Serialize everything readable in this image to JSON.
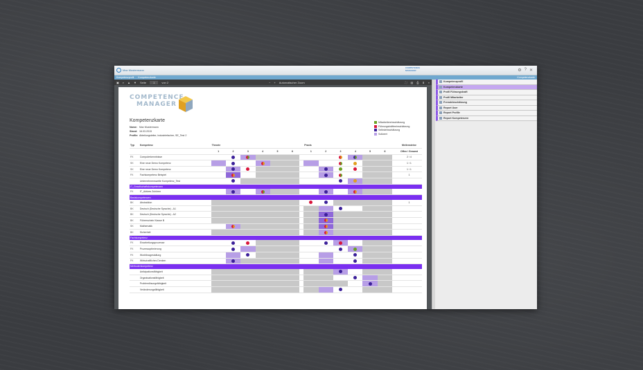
{
  "app": {
    "title": "Max Mustermann",
    "tabs": [
      "Kompetenzprofil",
      "Kompetenzkarte"
    ],
    "header_right_link": "Kompetenzkarte"
  },
  "pdf_toolbar": {
    "page_label": "Seite",
    "page_value": "1",
    "page_total": "von 2",
    "zoom": "Automatischer Zoom"
  },
  "doc": {
    "logo_line1": "COMPETENCE",
    "logo_line2": "MANAGER",
    "title": "Kompetenzkarte",
    "meta": [
      {
        "label": "Name:",
        "value": "Max Mustermann"
      },
      {
        "label": "Stand:",
        "value": "16.03.2015"
      },
      {
        "label": "Profile:",
        "value": "Abteilungsleiter, Industriefacher, SE_Test 2"
      }
    ],
    "legend": [
      {
        "label": "Mitarbeitereinschätzung",
        "color": "#6aa022"
      },
      {
        "label": "Führungskräfteeinschätzung",
        "color": "#d8143a"
      },
      {
        "label": "Selbsteinschätzung",
        "color": "#3b1f99"
      },
      {
        "label": "Sollwert",
        "color": "#b79ee6"
      }
    ],
    "head": {
      "typ": "Typ",
      "komp": "Kompetenz",
      "theorie": "Theorie",
      "praxis": "Praxis",
      "meilensteine": "Meilensteine",
      "scale": [
        "1",
        "2",
        "3",
        "4",
        "5",
        "6"
      ],
      "ms_sub": "Offen / Gesamt"
    },
    "sections": [
      {
        "title": "",
        "rows": [
          {
            "typ": "FK",
            "name": "Computerkenntnisse",
            "ms": "2 / 4",
            "t": [
              "wht",
              "wht",
              "lgt:r",
              "gray",
              "gray",
              "gray"
            ],
            "td": [
              "",
              "n",
              "rg",
              "",
              "",
              ""
            ],
            "p": [
              "wht",
              "wht",
              "wht",
              "lgt",
              "gray",
              "gray"
            ],
            "pd": [
              "",
              "",
              "ro",
              "ng",
              "",
              ""
            ]
          },
          {
            "typ": "SK",
            "name": "Eine neue Demo Kompetenz",
            "ms": "1 / 1",
            "t": [
              "lgt",
              "wht",
              "wht",
              "lgt",
              "gray",
              "gray"
            ],
            "td": [
              "",
              "n",
              "",
              "ro",
              "",
              ""
            ],
            "p": [
              "lgt",
              "wht",
              "wht",
              "wht",
              "gray",
              "gray"
            ],
            "pd": [
              "",
              "",
              "rg",
              "y",
              "",
              ""
            ]
          },
          {
            "typ": "SK",
            "name": "Eine neue Demo Kompetenz",
            "ms": "1 / 1",
            "t": [
              "wht",
              "lgt",
              "wht",
              "gray",
              "gray",
              "gray"
            ],
            "td": [
              "",
              "n",
              "r",
              "",
              "",
              ""
            ],
            "p": [
              "wht",
              "lgt",
              "wht",
              "wht",
              "gray",
              "gray"
            ],
            "pd": [
              "",
              "n",
              "g",
              "r",
              "",
              ""
            ]
          },
          {
            "typ": "FK",
            "name": "Fachkompetenz Beispiel",
            "ms": "1",
            "t": [
              "wht",
              "mid",
              "wht",
              "gray",
              "gray",
              "gray"
            ],
            "td": [
              "",
              "ro",
              "",
              "",
              "",
              ""
            ],
            "p": [
              "wht",
              "lgt",
              "wht",
              "wht",
              "gray",
              "gray"
            ],
            "pd": [
              "",
              "n",
              "rg",
              "",
              "",
              ""
            ]
          },
          {
            "typ": "",
            "name": "Unternehmensweite Kompetenz_Test",
            "ms": "",
            "t": [
              "wht",
              "wht",
              "gray",
              "gray",
              "gray",
              "gray"
            ],
            "td": [
              "",
              "n",
              "",
              "",
              "",
              ""
            ],
            "p": [
              "wht",
              "wht",
              "wht",
              "lgt",
              "gray",
              "gray"
            ],
            "pd": [
              "",
              "",
              "n",
              "y",
              "",
              ""
            ]
          }
        ]
      },
      {
        "title": "IT_Gesellschaftskompetenzen",
        "rows": [
          {
            "typ": "FK",
            "name": "IT_Aktives Zuhören",
            "ms": "",
            "t": [
              "wht",
              "lgt",
              "wht",
              "lgt",
              "gray",
              "gray"
            ],
            "td": [
              "",
              "n",
              "",
              "rg",
              "",
              ""
            ],
            "p": [
              "wht",
              "lgt",
              "wht",
              "lgt",
              "gray",
              "gray"
            ],
            "pd": [
              "",
              "n",
              "",
              "ro",
              "",
              ""
            ]
          }
        ]
      },
      {
        "title": "Basiskompetenzen",
        "rows": [
          {
            "typ": "BK",
            "name": "Abstraktion",
            "ms": "1",
            "t": [
              "gray",
              "gray",
              "gray",
              "gray",
              "gray",
              "gray"
            ],
            "td": [
              "",
              "",
              "",
              "",
              "",
              ""
            ],
            "p": [
              "wht",
              "wht",
              "gray",
              "gray",
              "gray",
              "gray"
            ],
            "pd": [
              "r",
              "n",
              "",
              "",
              "",
              ""
            ]
          },
          {
            "typ": "BK",
            "name": "Deutsch (Deutsche Sprache) - A1",
            "ms": "",
            "t": [
              "gray",
              "gray",
              "gray",
              "gray",
              "gray",
              "gray"
            ],
            "td": [
              "",
              "",
              "",
              "",
              "",
              ""
            ],
            "p": [
              "gray",
              "lgt",
              "wht",
              "wht",
              "gray",
              "gray"
            ],
            "pd": [
              "",
              "",
              "n",
              "",
              "",
              ""
            ]
          },
          {
            "typ": "BK",
            "name": "Deutsch (Deutsche Sprache) - A2",
            "ms": "",
            "t": [
              "gray",
              "gray",
              "gray",
              "gray",
              "gray",
              "gray"
            ],
            "td": [
              "",
              "",
              "",
              "",
              "",
              ""
            ],
            "p": [
              "gray",
              "mid",
              "gray",
              "gray",
              "gray",
              "gray"
            ],
            "pd": [
              "",
              "n",
              "",
              "",
              "",
              ""
            ]
          },
          {
            "typ": "BK",
            "name": "Führerschein Klasse B",
            "ms": "",
            "t": [
              "gray",
              "gray",
              "gray",
              "gray",
              "gray",
              "gray"
            ],
            "td": [
              "",
              "",
              "",
              "",
              "",
              ""
            ],
            "p": [
              "gray",
              "mid",
              "gray",
              "gray",
              "gray",
              "gray"
            ],
            "pd": [
              "",
              "ro",
              "",
              "",
              "",
              ""
            ]
          },
          {
            "typ": "SK",
            "name": "Mathematik",
            "ms": "",
            "t": [
              "wht",
              "lgt",
              "gray",
              "gray",
              "gray",
              "gray"
            ],
            "td": [
              "",
              "ro",
              "",
              "",
              "",
              ""
            ],
            "p": [
              "gray",
              "mid",
              "gray",
              "gray",
              "gray",
              "gray"
            ],
            "pd": [
              "",
              "ro",
              "",
              "",
              "",
              ""
            ]
          },
          {
            "typ": "BK",
            "name": "Sicherheit",
            "ms": "",
            "t": [
              "gray",
              "gray",
              "gray",
              "gray",
              "gray",
              "gray"
            ],
            "td": [
              "",
              "",
              "",
              "",
              "",
              ""
            ],
            "p": [
              "gray",
              "lgt",
              "gray",
              "gray",
              "gray",
              "gray"
            ],
            "pd": [
              "",
              "ro",
              "",
              "",
              "",
              ""
            ]
          }
        ]
      },
      {
        "title": "Fachkompetenz",
        "rows": [
          {
            "typ": "FK",
            "name": "Einarbeitungsprozesse",
            "ms": "",
            "t": [
              "wht",
              "wht",
              "wht",
              "gray",
              "gray",
              "gray"
            ],
            "td": [
              "",
              "n",
              "r",
              "",
              "",
              ""
            ],
            "p": [
              "wht",
              "wht",
              "lgt",
              "wht",
              "gray",
              "gray"
            ],
            "pd": [
              "",
              "n",
              "r",
              "",
              "",
              ""
            ]
          },
          {
            "typ": "FK",
            "name": "Prozessoptimierung",
            "ms": "",
            "t": [
              "wht",
              "wht",
              "lgt",
              "gray",
              "gray",
              "gray"
            ],
            "td": [
              "",
              "n",
              "",
              "",
              "",
              ""
            ],
            "p": [
              "wht",
              "wht",
              "wht",
              "lgt",
              "gray",
              "gray"
            ],
            "pd": [
              "",
              "",
              "n",
              "g",
              "",
              ""
            ]
          },
          {
            "typ": "FK",
            "name": "Workflowgestaltung",
            "ms": "",
            "t": [
              "wht",
              "lgt",
              "wht",
              "gray",
              "gray",
              "gray"
            ],
            "td": [
              "",
              "",
              "n",
              "",
              "",
              ""
            ],
            "p": [
              "wht",
              "lgt",
              "wht",
              "wht",
              "gray",
              "gray"
            ],
            "pd": [
              "",
              "",
              "",
              "n",
              "",
              ""
            ]
          },
          {
            "typ": "FK",
            "name": "Wirtschaftliches Denken",
            "ms": "",
            "t": [
              "wht",
              "lgt",
              "gray",
              "gray",
              "gray",
              "gray"
            ],
            "td": [
              "",
              "n",
              "",
              "",
              "",
              ""
            ],
            "p": [
              "wht",
              "lgt",
              "wht",
              "wht",
              "gray",
              "gray"
            ],
            "pd": [
              "",
              "",
              "",
              "n",
              "",
              ""
            ]
          }
        ]
      },
      {
        "title": "Methodenkompetenz",
        "rows": [
          {
            "typ": "",
            "name": "Antizipationsfähigkeit",
            "ms": "",
            "t": [
              "gray",
              "gray",
              "gray",
              "gray",
              "gray",
              "gray"
            ],
            "td": [
              "",
              "",
              "",
              "",
              "",
              ""
            ],
            "p": [
              "gray",
              "gray",
              "lgt",
              "wht",
              "gray",
              "gray"
            ],
            "pd": [
              "",
              "",
              "n",
              "",
              "",
              ""
            ]
          },
          {
            "typ": "",
            "name": "Organisationsfähigkeit",
            "ms": "",
            "t": [
              "gray",
              "gray",
              "gray",
              "gray",
              "gray",
              "gray"
            ],
            "td": [
              "",
              "",
              "",
              "",
              "",
              ""
            ],
            "p": [
              "gray",
              "gray",
              "wht",
              "wht",
              "lgt",
              "gray"
            ],
            "pd": [
              "",
              "",
              "",
              "n",
              "",
              ""
            ]
          },
          {
            "typ": "",
            "name": "Problemlösungsfähigkeit",
            "ms": "",
            "t": [
              "gray",
              "gray",
              "gray",
              "gray",
              "gray",
              "gray"
            ],
            "td": [
              "",
              "",
              "",
              "",
              "",
              ""
            ],
            "p": [
              "gray",
              "gray",
              "gray",
              "wht",
              "lgt",
              "gray"
            ],
            "pd": [
              "",
              "",
              "",
              "",
              "n",
              ""
            ]
          },
          {
            "typ": "",
            "name": "Veränderungsfähigkeit",
            "ms": "",
            "t": [
              "gray",
              "gray",
              "gray",
              "gray",
              "gray",
              "gray"
            ],
            "td": [
              "",
              "",
              "",
              "",
              "",
              ""
            ],
            "p": [
              "gray",
              "lgt",
              "wht",
              "wht",
              "gray",
              "gray"
            ],
            "pd": [
              "",
              "",
              "n",
              "",
              "",
              ""
            ]
          }
        ]
      }
    ]
  },
  "sidebar": {
    "items": [
      {
        "label": "Kompetenzprofil",
        "active": false
      },
      {
        "label": "Kompetenzkarte",
        "active": true
      },
      {
        "label": "Profil Führungskraft",
        "active": false
      },
      {
        "label": "Profil Mitarbeiter",
        "active": false
      },
      {
        "label": "Fremdeinschätzung",
        "active": false
      },
      {
        "label": "Report User",
        "active": false
      },
      {
        "label": "Report Profile",
        "active": false
      },
      {
        "label": "Report Kompetenzen",
        "active": false
      }
    ]
  }
}
